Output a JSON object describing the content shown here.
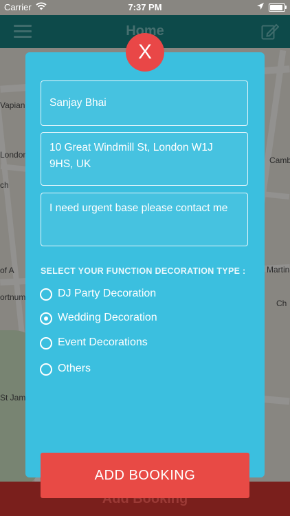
{
  "status_bar": {
    "carrier": "Carrier",
    "time": "7:37 PM"
  },
  "nav": {
    "title": "Home"
  },
  "map_labels": [
    "Vapiano",
    "London",
    "ch",
    "of A",
    "ortnum",
    "St Jam",
    "Camb",
    "Martin-",
    "Ch"
  ],
  "modal": {
    "close_label": "X",
    "name_value": "Sanjay Bhai",
    "address_value": "10 Great Windmill St, London W1J 9HS, UK",
    "message_value": "I need urgent base please contact me",
    "section_label": "SELECT YOUR FUNCTION DECORATION TYPE :",
    "options": [
      {
        "label": "DJ Party Decoration",
        "selected": false
      },
      {
        "label": "Wedding Decoration",
        "selected": true
      },
      {
        "label": "Event Decorations",
        "selected": false
      },
      {
        "label": "Others",
        "selected": false
      }
    ],
    "submit_label": "ADD BOOKING"
  },
  "bottom_bar": {
    "label": "Add Booking"
  },
  "colors": {
    "modal_bg": "#3bbfdf",
    "accent_red": "#e84a45",
    "nav_bg": "#0d4a4a"
  }
}
